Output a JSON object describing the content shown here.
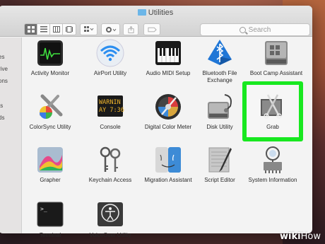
{
  "window": {
    "title": "Utilities"
  },
  "search": {
    "placeholder": "Search"
  },
  "sidebar": {
    "items": [
      "es",
      "rive",
      "ons",
      "ts",
      "ds"
    ]
  },
  "apps": [
    {
      "name": "Activity Monitor"
    },
    {
      "name": "AirPort Utility"
    },
    {
      "name": "Audio MIDI Setup"
    },
    {
      "name": "Bluetooth File Exchange"
    },
    {
      "name": "Boot Camp Assistant"
    },
    {
      "name": "ColorSync Utility"
    },
    {
      "name": "Console",
      "icon_text": "WARNIN AY 7:36"
    },
    {
      "name": "Digital Color Meter"
    },
    {
      "name": "Disk Utility"
    },
    {
      "name": "Grab"
    },
    {
      "name": "Grapher"
    },
    {
      "name": "Keychain Access"
    },
    {
      "name": "Migration Assistant"
    },
    {
      "name": "Script Editor"
    },
    {
      "name": "System Information"
    },
    {
      "name": "Terminal"
    },
    {
      "name": "VoiceOver Utility"
    }
  ],
  "highlight_color": "#18e820",
  "watermark": {
    "wiki": "wiki",
    "how": "How"
  }
}
